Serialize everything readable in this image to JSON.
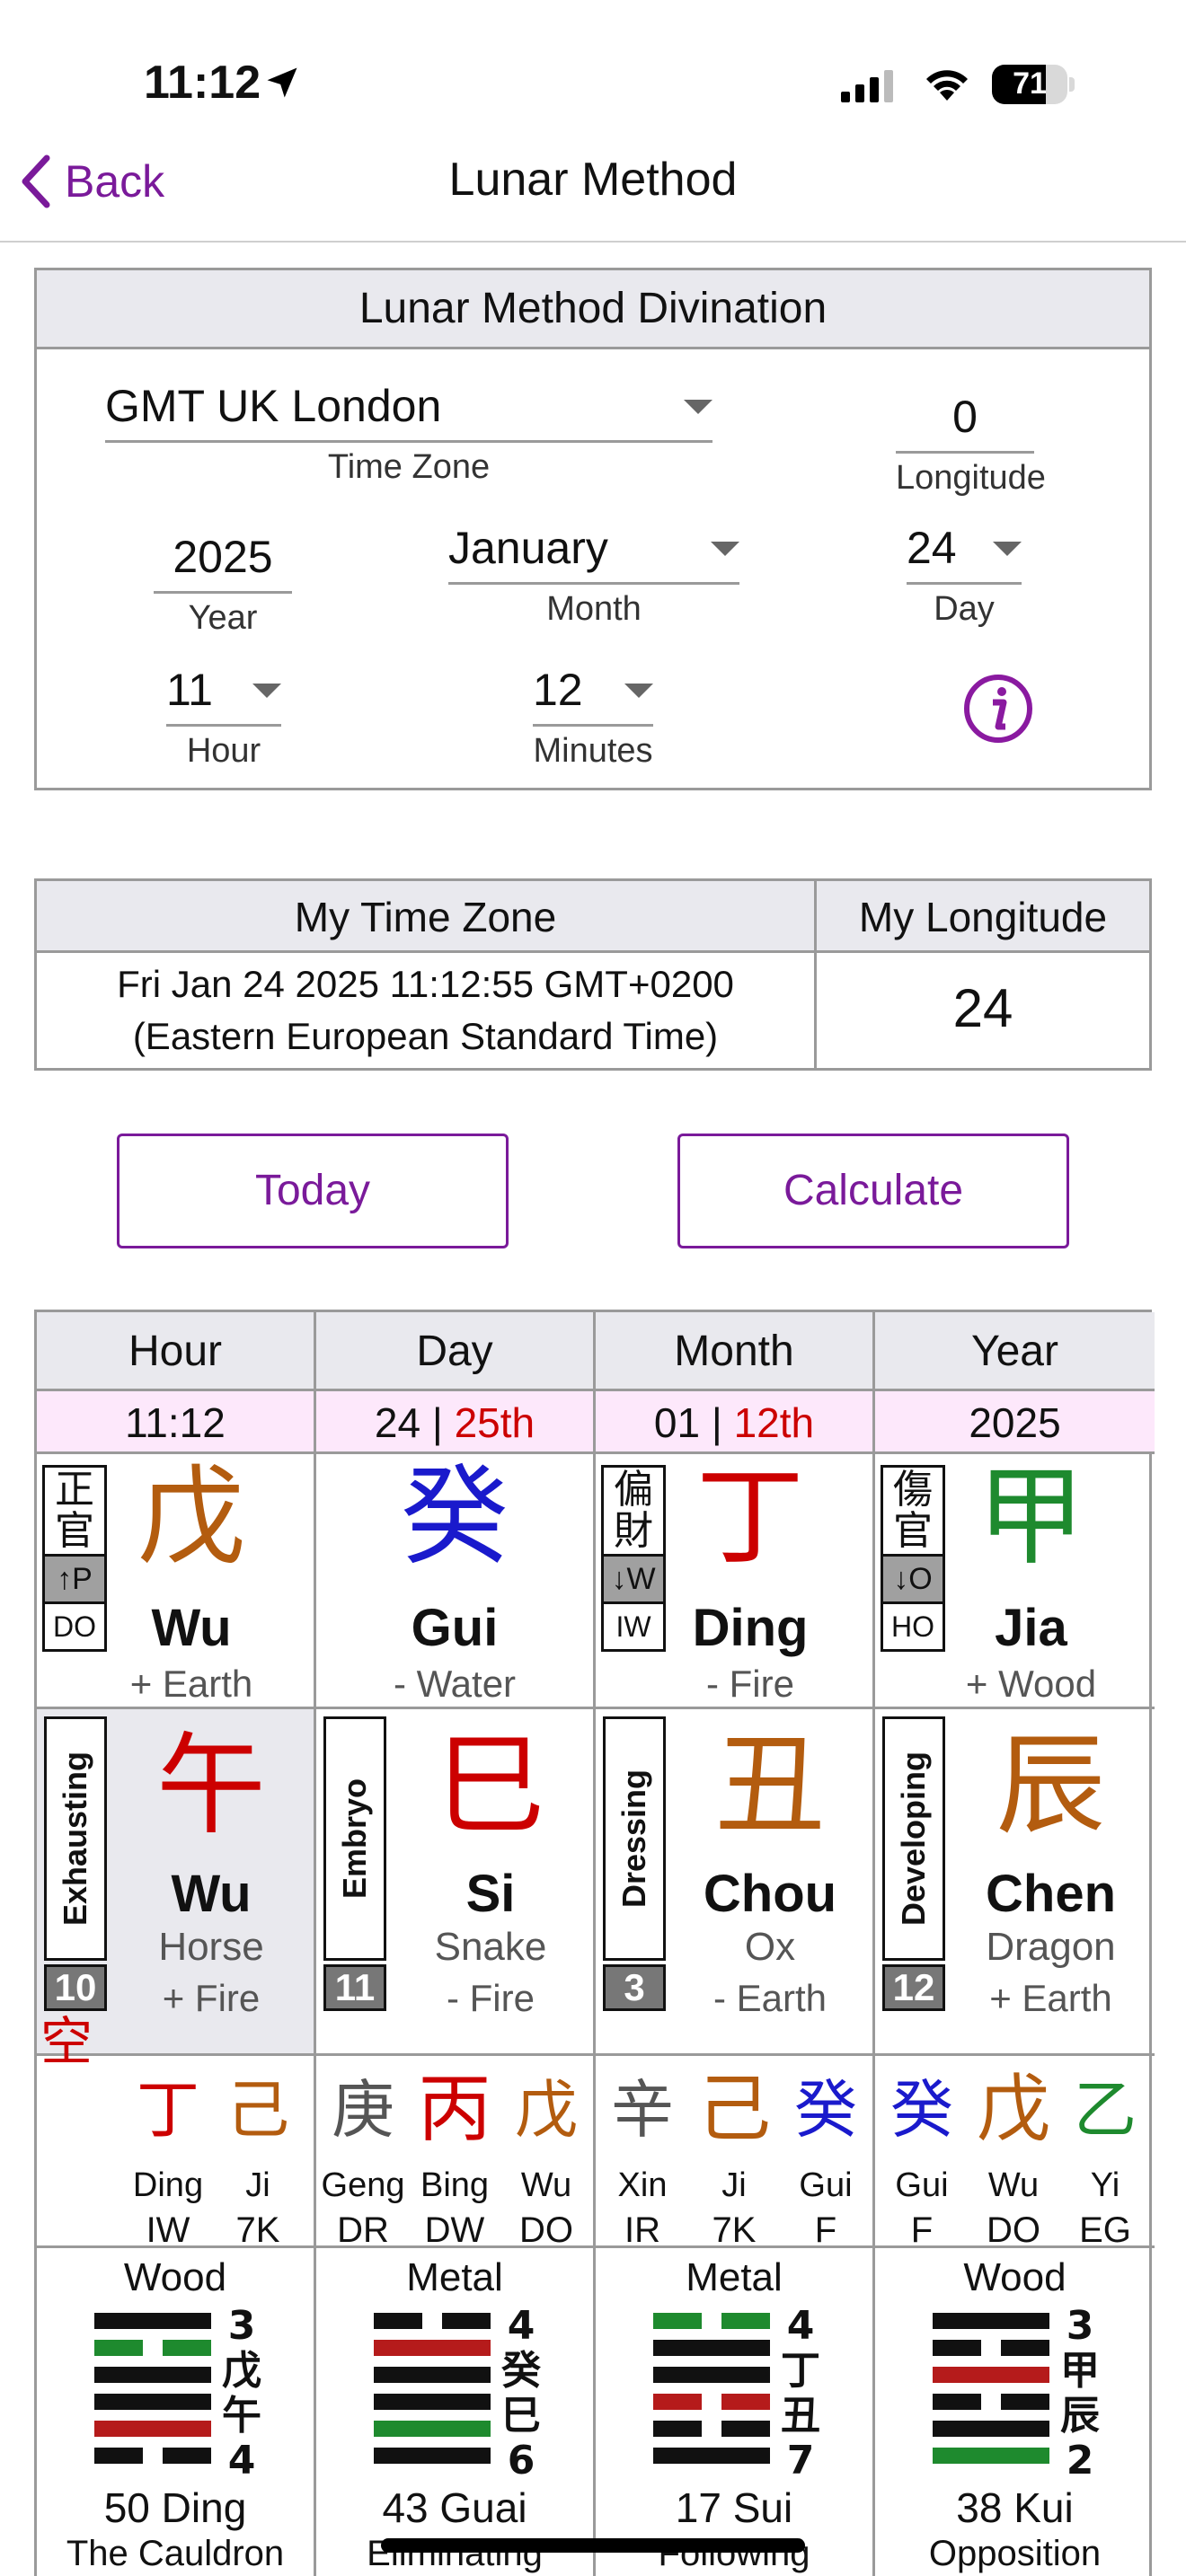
{
  "status": {
    "time": "11:12",
    "battery": "71",
    "battery_level": 0.71
  },
  "nav": {
    "back": "Back",
    "title": "Lunar Method"
  },
  "panel": {
    "title": "Lunar Method Divination",
    "timezone": {
      "value": "GMT UK London",
      "label": "Time Zone"
    },
    "longitude": {
      "value": "0",
      "label": "Longitude"
    },
    "year": {
      "value": "2025",
      "label": "Year"
    },
    "month": {
      "value": "January",
      "label": "Month"
    },
    "day": {
      "value": "24",
      "label": "Day"
    },
    "hour": {
      "value": "11",
      "label": "Hour"
    },
    "minutes": {
      "value": "12",
      "label": "Minutes"
    }
  },
  "tz": {
    "col1_header": "My Time Zone",
    "col2_header": "My Longitude",
    "time_line1": "Fri Jan 24 2025 11:12:55 GMT+0200",
    "time_line2": "(Eastern European Standard Time)",
    "longitude": "24"
  },
  "buttons": {
    "today": "Today",
    "calculate": "Calculate"
  },
  "pillars": [
    {
      "header": "Hour",
      "sub": "11:12",
      "sub_extra": "",
      "stem": {
        "char": "戊",
        "color": "#b35c0f",
        "pinyin": "Wu",
        "element": "+ Earth",
        "tag": {
          "z1": "正",
          "z2": "官",
          "dir": "↑P",
          "code": "DO"
        }
      },
      "branch": {
        "phase": "Exhausting",
        "num": "10",
        "void": "空",
        "char": "午",
        "color": "#cc0000",
        "pinyin": "Wu",
        "animal": "Horse",
        "element": "+ Fire"
      },
      "hidden": [
        {
          "char": "丁",
          "color": "#cc0000",
          "pinyin": "Ding",
          "code": "IW"
        },
        {
          "char": "己",
          "color": "#b35c0f",
          "pinyin": "Ji",
          "code": "7K"
        }
      ],
      "hex": {
        "element": "Wood",
        "name": "50 Ding",
        "desc": "The Cauldron",
        "side": [
          "3",
          "戊",
          "午",
          "4"
        ]
      }
    },
    {
      "header": "Day",
      "sub": "24 | ",
      "sub_extra": "25th",
      "stem": {
        "char": "癸",
        "color": "#1a1acc",
        "pinyin": "Gui",
        "element": "- Water"
      },
      "branch": {
        "phase": "Embryo",
        "num": "11",
        "char": "巳",
        "color": "#cc0000",
        "pinyin": "Si",
        "animal": "Snake",
        "element": "- Fire"
      },
      "hidden": [
        {
          "char": "庚",
          "color": "#555555",
          "pinyin": "Geng",
          "code": "DR"
        },
        {
          "char": "丙",
          "color": "#cc0000",
          "pinyin": "Bing",
          "code": "DW"
        },
        {
          "char": "戊",
          "color": "#b35c0f",
          "pinyin": "Wu",
          "code": "DO"
        }
      ],
      "hex": {
        "element": "Metal",
        "name": "43 Guai",
        "desc": "Eliminating",
        "side": [
          "4",
          "癸",
          "巳",
          "6"
        ]
      }
    },
    {
      "header": "Month",
      "sub": "01 | ",
      "sub_extra": "12th",
      "stem": {
        "char": "丁",
        "color": "#cc0000",
        "pinyin": "Ding",
        "element": "- Fire",
        "tag": {
          "z1": "偏",
          "z2": "財",
          "dir": "↓W",
          "code": "IW"
        }
      },
      "branch": {
        "phase": "Dressing",
        "num": "3",
        "char": "丑",
        "color": "#b35c0f",
        "pinyin": "Chou",
        "animal": "Ox",
        "element": "- Earth"
      },
      "hidden": [
        {
          "char": "辛",
          "color": "#555555",
          "pinyin": "Xin",
          "code": "IR"
        },
        {
          "char": "己",
          "color": "#b35c0f",
          "pinyin": "Ji",
          "code": "7K"
        },
        {
          "char": "癸",
          "color": "#1a1acc",
          "pinyin": "Gui",
          "code": "F"
        }
      ],
      "hex": {
        "element": "Metal",
        "name": "17 Sui",
        "desc": "Following",
        "side": [
          "4",
          "丁",
          "丑",
          "7"
        ]
      }
    },
    {
      "header": "Year",
      "sub": "2025",
      "sub_extra": "",
      "stem": {
        "char": "甲",
        "color": "#1e8a2e",
        "pinyin": "Jia",
        "element": "+ Wood",
        "tag": {
          "z1": "傷",
          "z2": "官",
          "dir": "↓O",
          "code": "HO"
        }
      },
      "branch": {
        "phase": "Developing",
        "num": "12",
        "char": "辰",
        "color": "#b35c0f",
        "pinyin": "Chen",
        "animal": "Dragon",
        "element": "+ Earth"
      },
      "hidden": [
        {
          "char": "癸",
          "color": "#1a1acc",
          "pinyin": "Gui",
          "code": "F"
        },
        {
          "char": "戊",
          "color": "#b35c0f",
          "pinyin": "Wu",
          "code": "DO"
        },
        {
          "char": "乙",
          "color": "#1e8a2e",
          "pinyin": "Yi",
          "code": "EG"
        }
      ],
      "hex": {
        "element": "Wood",
        "name": "38 Kui",
        "desc": "Opposition",
        "side": [
          "3",
          "甲",
          "辰",
          "2"
        ]
      }
    }
  ]
}
